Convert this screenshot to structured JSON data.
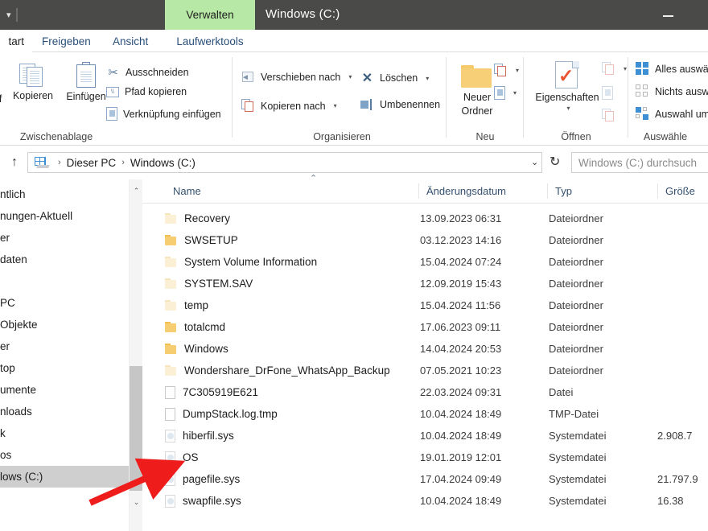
{
  "titlebar": {
    "quick_access_chevron": "▾",
    "contextual_tab": "Verwalten",
    "window_title": "Windows  (C:)",
    "minimize_label": "Minimieren"
  },
  "tabs": [
    {
      "label": "tart",
      "name": "tab-start",
      "active": true
    },
    {
      "label": "Freigeben",
      "name": "tab-share",
      "active": false
    },
    {
      "label": "Ansicht",
      "name": "tab-view",
      "active": false
    },
    {
      "label": "Laufwerktools",
      "name": "tab-drivetools",
      "active": false
    }
  ],
  "ribbon": {
    "clipboard": {
      "group_title": "Zwischenablage",
      "pin_label": "ff",
      "copy_label": "Kopieren",
      "paste_label": "Einfügen",
      "cut_label": "Ausschneiden",
      "copy_path_label": "Pfad kopieren",
      "paste_shortcut_label": "Verknüpfung einfügen"
    },
    "organize": {
      "group_title": "Organisieren",
      "move_to_label": "Verschieben nach",
      "copy_to_label": "Kopieren nach",
      "delete_label": "Löschen",
      "rename_label": "Umbenennen",
      "caret": "▾"
    },
    "new": {
      "group_title": "Neu",
      "new_folder_label_line1": "Neuer",
      "new_folder_label_line2": "Ordner",
      "caret": "▾"
    },
    "open": {
      "group_title": "Öffnen",
      "properties_label": "Eigenschaften",
      "caret": "▾"
    },
    "select": {
      "group_title": "Auswähle",
      "select_all_label": "Alles auswä",
      "select_none_label": "Nichts ausw",
      "invert_selection_label": "Auswahl um"
    }
  },
  "address": {
    "up_arrow": "↑",
    "breadcrumb": [
      "Dieser PC",
      "Windows  (C:)"
    ],
    "separator": "›",
    "dropdown_caret": "⌄",
    "refresh_icon": "↻",
    "search_placeholder": "Windows  (C:) durchsuch"
  },
  "navpane": {
    "items": [
      {
        "label": "ntlich",
        "selected": false
      },
      {
        "label": "nungen-Aktuell",
        "selected": false
      },
      {
        "label": "er",
        "selected": false
      },
      {
        "label": "daten",
        "selected": false
      },
      {
        "label": "",
        "selected": false
      },
      {
        "label": " PC",
        "selected": false
      },
      {
        "label": "Objekte",
        "selected": false
      },
      {
        "label": "er",
        "selected": false
      },
      {
        "label": "top",
        "selected": false
      },
      {
        "label": "umente",
        "selected": false
      },
      {
        "label": "nloads",
        "selected": false
      },
      {
        "label": "k",
        "selected": false
      },
      {
        "label": "os",
        "selected": false
      },
      {
        "label": "lows  (C:)",
        "selected": true
      }
    ],
    "scroll_up": "⌃",
    "scroll_down": "⌄"
  },
  "filelist": {
    "columns": [
      "Name",
      "Änderungsdatum",
      "Typ",
      "Größe"
    ],
    "sort_indicator": "⌃",
    "rows": [
      {
        "name": "Recovery",
        "date": "13.09.2023 06:31",
        "type": "Dateiordner",
        "size": "",
        "icon": "folder-dim"
      },
      {
        "name": "SWSETUP",
        "date": "03.12.2023 14:16",
        "type": "Dateiordner",
        "size": "",
        "icon": "folder"
      },
      {
        "name": "System Volume Information",
        "date": "15.04.2024 07:24",
        "type": "Dateiordner",
        "size": "",
        "icon": "folder-dim"
      },
      {
        "name": "SYSTEM.SAV",
        "date": "12.09.2019 15:43",
        "type": "Dateiordner",
        "size": "",
        "icon": "folder-dim"
      },
      {
        "name": "temp",
        "date": "15.04.2024 11:56",
        "type": "Dateiordner",
        "size": "",
        "icon": "folder-dim"
      },
      {
        "name": "totalcmd",
        "date": "17.06.2023 09:11",
        "type": "Dateiordner",
        "size": "",
        "icon": "folder"
      },
      {
        "name": "Windows",
        "date": "14.04.2024 20:53",
        "type": "Dateiordner",
        "size": "",
        "icon": "folder"
      },
      {
        "name": "Wondershare_DrFone_WhatsApp_Backup",
        "date": "07.05.2021 10:23",
        "type": "Dateiordner",
        "size": "",
        "icon": "folder-dim"
      },
      {
        "name": "7C305919E621",
        "date": "22.03.2024 09:31",
        "type": "Datei",
        "size": "",
        "icon": "doc"
      },
      {
        "name": "DumpStack.log.tmp",
        "date": "10.04.2024 18:49",
        "type": "TMP-Datei",
        "size": "",
        "icon": "doc"
      },
      {
        "name": "hiberfil.sys",
        "date": "10.04.2024 18:49",
        "type": "Systemdatei",
        "size": "2.908.7",
        "icon": "sysfile"
      },
      {
        "name": "OS",
        "date": "19.01.2019 12:01",
        "type": "Systemdatei",
        "size": "",
        "icon": "sysfile"
      },
      {
        "name": "pagefile.sys",
        "date": "17.04.2024 09:49",
        "type": "Systemdatei",
        "size": "21.797.9",
        "icon": "sysfile"
      },
      {
        "name": "swapfile.sys",
        "date": "10.04.2024 18:49",
        "type": "Systemdatei",
        "size": "16.38",
        "icon": "sysfile"
      }
    ]
  },
  "annotation": {
    "arrow_color": "#ef1c1c",
    "points_to": "pagefile.sys"
  },
  "colors": {
    "titlebar": "#4a4a48",
    "contextual_tab_green": "#b8e8a5",
    "accent_blue": "#3f8fd4",
    "selection_gray": "#cfcfcf"
  }
}
